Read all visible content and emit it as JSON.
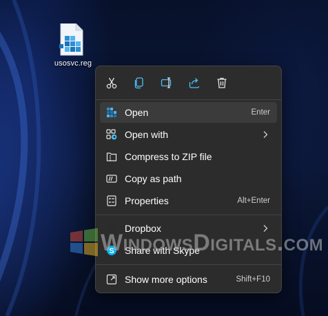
{
  "desktop": {
    "file_name": "usosvc.reg",
    "file_icon": "registry-file-icon"
  },
  "toolbar": {
    "buttons": [
      {
        "name": "cut",
        "icon": "scissors-icon"
      },
      {
        "name": "copy",
        "icon": "copy-icon"
      },
      {
        "name": "rename",
        "icon": "rename-icon"
      },
      {
        "name": "share",
        "icon": "share-icon"
      },
      {
        "name": "delete",
        "icon": "trash-icon"
      }
    ]
  },
  "menu": {
    "items": [
      {
        "label": "Open",
        "accel": "Enter",
        "icon": "registry-icon",
        "selected": true
      },
      {
        "label": "Open with",
        "accel": "",
        "icon": "open-with-icon",
        "submenu": true
      },
      {
        "label": "Compress to ZIP file",
        "accel": "",
        "icon": "zip-folder-icon"
      },
      {
        "label": "Copy as path",
        "accel": "",
        "icon": "copy-path-icon"
      },
      {
        "label": "Properties",
        "accel": "Alt+Enter",
        "icon": "properties-icon"
      },
      {
        "label": "Dropbox",
        "accel": "",
        "icon": "dropbox-icon",
        "submenu": true
      },
      {
        "label": "Share with Skype",
        "accel": "",
        "icon": "skype-icon"
      },
      {
        "label": "Show more options",
        "accel": "Shift+F10",
        "icon": "show-more-icon"
      }
    ]
  },
  "watermark": {
    "text": "WindowsDigitals.com"
  },
  "colors": {
    "menu_bg": "#2c2c2c",
    "selected_bg": "#3b3b3b",
    "accent_blue": "#4cc2ff",
    "skype_blue": "#00aff0"
  }
}
